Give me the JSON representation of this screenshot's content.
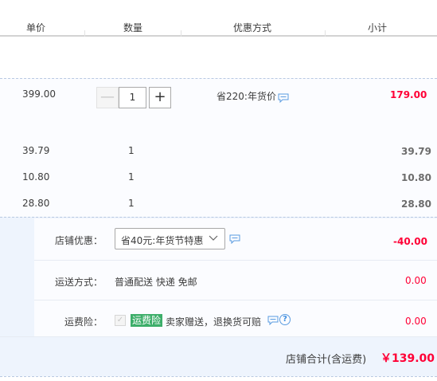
{
  "header": {
    "col_unit_price": "单价",
    "col_quantity": "数量",
    "col_discount": "优惠方式",
    "col_subtotal": "小计"
  },
  "main_item": {
    "unit_price": "399.00",
    "quantity": "1",
    "minus_label": "—",
    "plus_label": "+",
    "promo_text": "省220:年货价",
    "subtotal": "179.00"
  },
  "sub_items": [
    {
      "unit_price": "39.79",
      "quantity": "1",
      "subtotal": "39.79"
    },
    {
      "unit_price": "10.80",
      "quantity": "1",
      "subtotal": "10.80"
    },
    {
      "unit_price": "28.80",
      "quantity": "1",
      "subtotal": "28.80"
    }
  ],
  "shop": {
    "discount_label": "店铺优惠：",
    "discount_selected": "省40元:年货节特惠",
    "discount_amount": "-40.00",
    "shipping_label": "运送方式：",
    "shipping_value": "普通配送 快递 免邮",
    "shipping_amount": "0.00",
    "insurance_label": "运费险：",
    "insurance_tag": "运费险",
    "insurance_desc": "卖家赠送，退换货可赔",
    "insurance_amount": "0.00",
    "checkbox_mark": "✓",
    "help_mark": "?"
  },
  "footer": {
    "total_label": "店铺合计(含运费)",
    "total_value": "￥139.00"
  },
  "colors": {
    "accent_red": "#ff0036",
    "insurance_green": "#3dae6a",
    "section_bg": "#eef4fd"
  },
  "icons": [
    "message-icon",
    "chevron-down-icon",
    "question-icon",
    "checkbox-check-icon"
  ]
}
